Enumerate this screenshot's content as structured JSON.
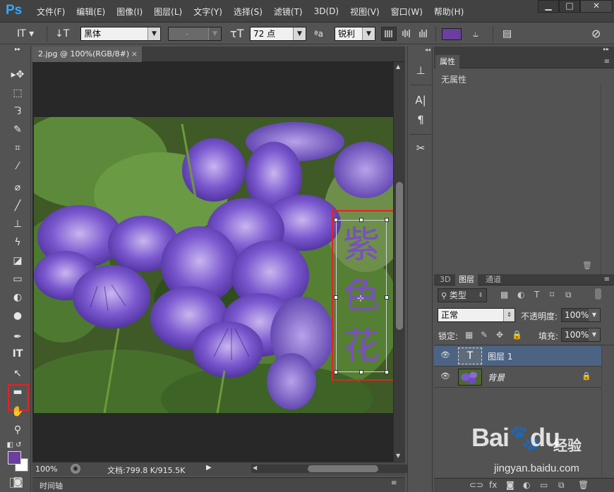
{
  "app": {
    "logo": "Ps"
  },
  "menu": [
    "文件(F)",
    "编辑(E)",
    "图像(I)",
    "图层(L)",
    "文字(Y)",
    "选择(S)",
    "滤镜(T)",
    "3D(D)",
    "视图(V)",
    "窗口(W)",
    "帮助(H)"
  ],
  "window_controls": {
    "minimize": "▁",
    "maximize": "□",
    "close": "✕"
  },
  "options": {
    "font_family": "黑体",
    "font_style": "-",
    "font_size": "72 点",
    "aa_label": "ªa",
    "antialias": "锐利",
    "text_color": "#6a3fa0"
  },
  "document": {
    "tab_title": "2.jpg @ 100%(RGB/8#)",
    "tab_close": "×",
    "text_layer_content": [
      "紫",
      "色",
      "花"
    ],
    "text_color": "#7a4fc2",
    "highlight_color": "#e0232a"
  },
  "status": {
    "zoom": "100%",
    "doc_info": "文档:799.8 K/915.5K"
  },
  "timeline": {
    "label": "时间轴"
  },
  "properties": {
    "tab_label": "属性",
    "empty_text": "无属性"
  },
  "layers_panel": {
    "tabs": [
      "3D",
      "图层",
      "通道"
    ],
    "filter_kind": "类型",
    "blend_mode": "正常",
    "opacity_label": "不透明度:",
    "opacity_value": "100%",
    "lock_label": "锁定:",
    "fill_label": "填充:",
    "fill_value": "100%",
    "layers": [
      {
        "name": "图层 1",
        "type": "text",
        "selected": true
      },
      {
        "name": "背景",
        "type": "image",
        "locked": true
      }
    ]
  },
  "colors": {
    "foreground": "#6a3fa0",
    "background": "#ffffff"
  },
  "watermark": {
    "brand": "Bai",
    "brand_suffix": "du",
    "cn": "经验",
    "url": "jingyan.baidu.com"
  }
}
